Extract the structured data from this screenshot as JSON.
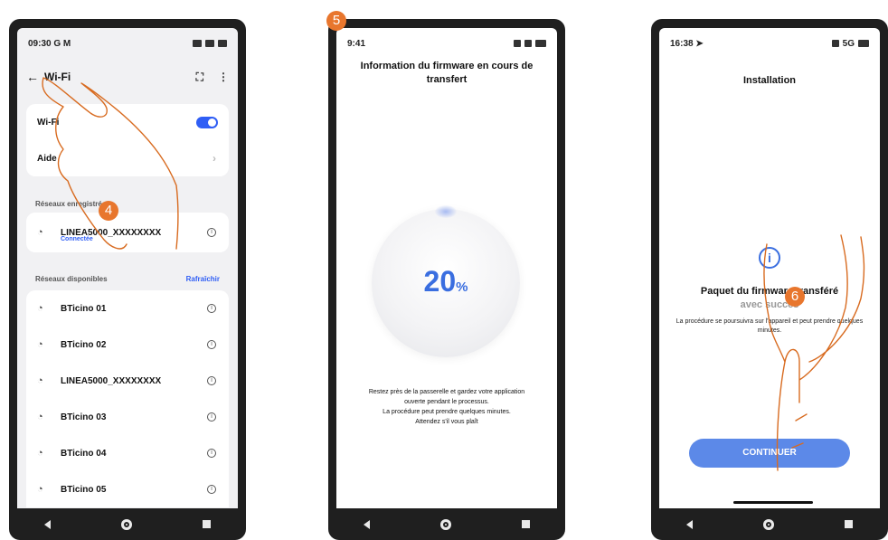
{
  "steps": {
    "s4": "4",
    "s5": "5",
    "s6": "6"
  },
  "phone1": {
    "status_left": "09:30 G M",
    "header_title": "Wi-Fi",
    "wifi_row_label": "Wi-Fi",
    "wifi_enabled": true,
    "help_row_label": "Aide",
    "saved_section": "Réseaux enregistrés",
    "saved_network": {
      "name": "LINEA5000_XXXXXXXX",
      "status": "Connectée"
    },
    "available_section": "Réseaux disponibles",
    "refresh_label": "Rafraîchir",
    "networks": [
      "BTicino 01",
      "BTicino 02",
      "LINEA5000_XXXXXXXX",
      "BTicino 03",
      "BTicino 04",
      "BTicino 05"
    ]
  },
  "phone2": {
    "status_time": "9:41",
    "title": "Information du firmware en cours de transfert",
    "progress_number": "20",
    "progress_unit": "%",
    "progress_fraction": 0.2,
    "description_lines": [
      "Restez près de la passerelle et gardez votre application",
      "ouverte pendant le processus.",
      "La procédure peut prendre quelques minutes.",
      "Attendez s'il vous plaît"
    ]
  },
  "phone3": {
    "status_time": "16:38",
    "status_network": "5G",
    "title": "Installation",
    "message_line1": "Paquet du firmware transféré",
    "message_line2": "avec succès",
    "sub_message": "La procédure se poursuivra sur l'appareil et peut prendre quelques minutes.",
    "button_label": "CONTINUER"
  },
  "colors": {
    "accent_orange": "#e8762d",
    "accent_blue": "#2f5ef5",
    "button_blue": "#5c89e8"
  }
}
